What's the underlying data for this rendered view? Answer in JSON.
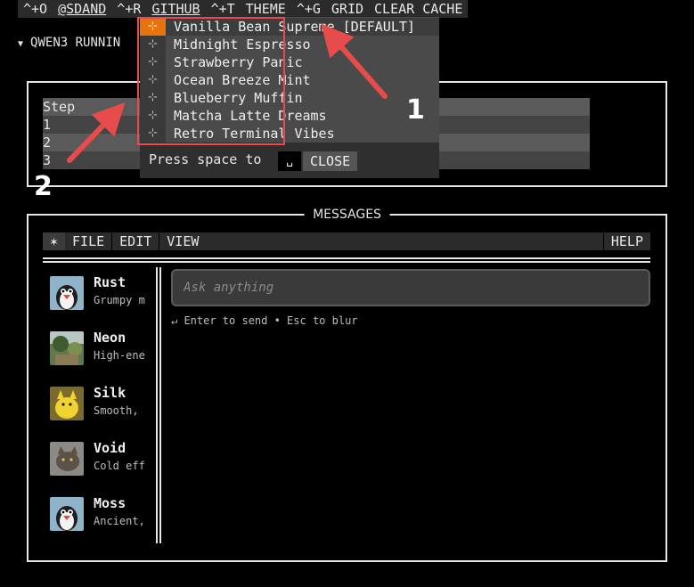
{
  "topbar": {
    "items": [
      "^+O",
      "@SDAND",
      "^+R",
      "GITHUB",
      "^+T",
      "THEME",
      "^+G",
      "GRID",
      "CLEAR CACHE"
    ]
  },
  "status": {
    "running": "QWEN3 RUNNIN"
  },
  "steps": {
    "header": "Step",
    "rows": [
      "1",
      "2",
      "3"
    ]
  },
  "messages": {
    "title": "MESSAGES",
    "menu": {
      "star": "✶",
      "file": "FILE",
      "edit": "EDIT",
      "view": "VIEW",
      "help": "HELP"
    },
    "agents": [
      {
        "name": "Rust",
        "desc": "Grumpy m"
      },
      {
        "name": "Neon",
        "desc": "High-ene"
      },
      {
        "name": "Silk",
        "desc": "Smooth,"
      },
      {
        "name": "Void",
        "desc": "Cold eff"
      },
      {
        "name": "Moss",
        "desc": "Ancient,"
      }
    ],
    "input_placeholder": "Ask anything",
    "hint": "↵ Enter to send • Esc to blur"
  },
  "theme_dropdown": {
    "items": [
      {
        "label": "Vanilla Bean Supreme [DEFAULT]",
        "selected": true
      },
      {
        "label": "Midnight Espresso",
        "selected": false
      },
      {
        "label": "Strawberry Panic",
        "selected": false
      },
      {
        "label": "Ocean Breeze Mint",
        "selected": false
      },
      {
        "label": "Blueberry Muffin",
        "selected": false
      },
      {
        "label": "Matcha Latte Dreams",
        "selected": false
      },
      {
        "label": "Retro Terminal Vibes",
        "selected": false
      }
    ],
    "footer_text": "Press space to",
    "key": "␣",
    "close_label": "CLOSE"
  },
  "annotations": {
    "num1": "1",
    "num2": "2"
  },
  "colors": {
    "accent": "#e8720c",
    "annotation": "#e84b4b"
  }
}
